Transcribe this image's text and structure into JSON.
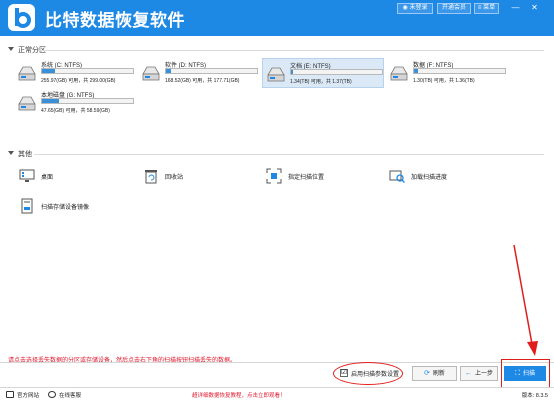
{
  "header": {
    "app_title": "比特数据恢复软件",
    "login_label": "未登录",
    "vip_label": "开通会员",
    "menu_label": "菜单",
    "minimize": "—",
    "close": "✕"
  },
  "partitions_section": {
    "title": "正常分区",
    "items": [
      {
        "name": "系统 (C: NTFS)",
        "size": "255.97(GB) 可用，共 299.00(GB)",
        "used_fraction": 0.14,
        "selected": false
      },
      {
        "name": "软件 (D: NTFS)",
        "size": "168.52(GB) 可用，共 177.71(GB)",
        "used_fraction": 0.05,
        "selected": false
      },
      {
        "name": "文档 (E: NTFS)",
        "size": "1.34(TB) 可用，共 1.37(TB)",
        "used_fraction": 0.02,
        "selected": true
      },
      {
        "name": "数据 (F: NTFS)",
        "size": "1.30(TB) 可用，共 1.36(TB)",
        "used_fraction": 0.04,
        "selected": false
      },
      {
        "name": "本地磁盘 (G: NTFS)",
        "size": "47.65(GB) 可用，共 58.59(GB)",
        "used_fraction": 0.19,
        "selected": false
      }
    ]
  },
  "other_section": {
    "title": "其他",
    "items": [
      {
        "label": "桌面",
        "icon": "desktop-icon"
      },
      {
        "label": "回收站",
        "icon": "recycle-bin-icon"
      },
      {
        "label": "指定扫描位置",
        "icon": "scan-location-icon"
      },
      {
        "label": "加载扫描进度",
        "icon": "load-progress-icon"
      },
      {
        "label": "扫描存储设备镜像",
        "icon": "disk-image-icon"
      }
    ]
  },
  "footer": {
    "hint": "请点击选择丢失数据的分区或存储设备，然后点击右下角的扫描按钮扫描丢失的数据。",
    "enable_scan_params": "启用扫描参数设置",
    "checkbox_mark": "☑",
    "refresh_label": "刷新",
    "back_label": "上一步",
    "scan_label": "扫描"
  },
  "status_bar": {
    "website": "官方网站",
    "support": "在线客服",
    "tutorial": "超详细数据恢复教程，点击立即观看！",
    "version": "版本: 8.3.5"
  },
  "colors": {
    "brand_blue": "#1e88e5",
    "annotation_red": "#e01d1d",
    "hint_red": "#e0182d"
  }
}
